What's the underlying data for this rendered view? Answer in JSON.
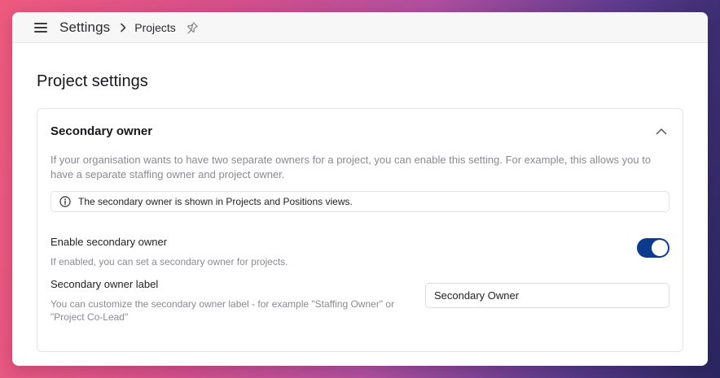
{
  "header": {
    "root": "Settings",
    "current": "Projects"
  },
  "page": {
    "title": "Project settings"
  },
  "secondary_owner": {
    "title": "Secondary owner",
    "description": "If your organisation wants to have two separate owners for a project, you can enable this setting. For example, this allows you to have a separate staffing owner and project owner.",
    "info": "The secondary owner is shown in Projects and Positions views.",
    "enable": {
      "label": "Enable secondary owner",
      "help": "If enabled, you can set a secondary owner for projects.",
      "enabled": true
    },
    "owner_label": {
      "label": "Secondary owner label",
      "help": "You can customize the secondary owner label - for example \"Staffing Owner\" or \"Project Co-Lead\"",
      "value": "Secondary Owner"
    }
  },
  "colors": {
    "toggle_on": "#0c3a8c",
    "muted_text": "#8a8a92"
  },
  "icons": {
    "menu": "hamburger-icon",
    "separator": "chevron-right-icon",
    "pin": "pin-icon",
    "collapse": "chevron-up-icon",
    "info": "info-icon"
  }
}
